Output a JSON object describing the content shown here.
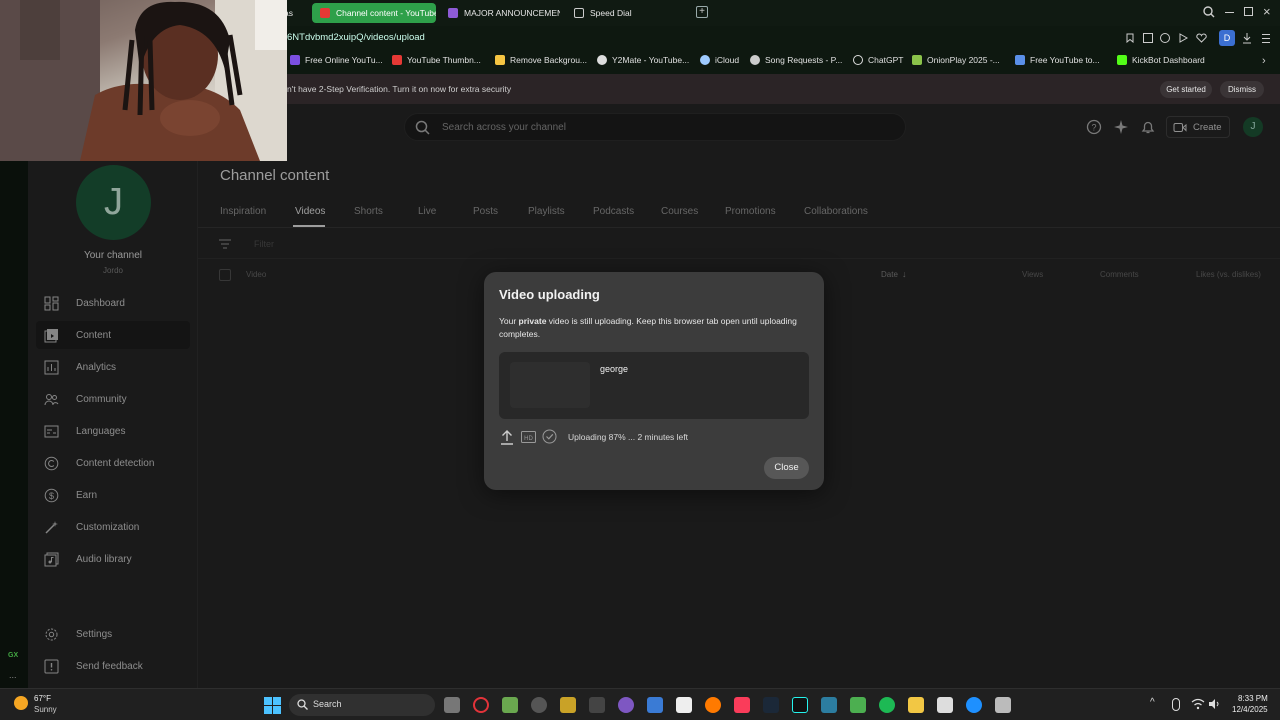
{
  "browser": {
    "tabs": [
      {
        "label": "as",
        "active": false
      },
      {
        "label": "Channel content - YouTube",
        "active": true
      },
      {
        "label": "MAJOR ANNOUNCEMENT",
        "active": false
      },
      {
        "label": "Speed Dial",
        "active": false
      }
    ],
    "address": "6NTdvbmd2xuipQ/videos/upload",
    "profile_initial": "D",
    "bookmarks": [
      {
        "label": "Free Online YouTu..."
      },
      {
        "label": "YouTube Thumbn..."
      },
      {
        "label": "Remove Backgrou..."
      },
      {
        "label": "Y2Mate - YouTube..."
      },
      {
        "label": "iCloud"
      },
      {
        "label": "Song Requests - P..."
      },
      {
        "label": "ChatGPT"
      },
      {
        "label": "OnionPlay 2025 -..."
      },
      {
        "label": "Free YouTube to..."
      },
      {
        "label": "KickBot Dashboard"
      }
    ]
  },
  "notice": {
    "text": "n't have 2-Step Verification. Turn it on now for extra security",
    "get_started": "Get started",
    "dismiss": "Dismiss"
  },
  "header": {
    "search_placeholder": "Search across your channel",
    "create_label": "Create",
    "avatar_initial": "J"
  },
  "sidebar": {
    "avatar_initial": "J",
    "channel_title": "Your channel",
    "channel_name": "Jordo",
    "items": [
      {
        "label": "Dashboard",
        "icon": "dashboard-icon"
      },
      {
        "label": "Content",
        "icon": "content-icon",
        "active": true
      },
      {
        "label": "Analytics",
        "icon": "analytics-icon"
      },
      {
        "label": "Community",
        "icon": "community-icon"
      },
      {
        "label": "Languages",
        "icon": "languages-icon"
      },
      {
        "label": "Content detection",
        "icon": "copyright-icon"
      },
      {
        "label": "Earn",
        "icon": "dollar-icon"
      },
      {
        "label": "Customization",
        "icon": "wand-icon"
      },
      {
        "label": "Audio library",
        "icon": "audio-library-icon"
      }
    ],
    "settings": "Settings",
    "feedback": "Send feedback"
  },
  "main": {
    "title": "Channel content",
    "tabs": [
      "Inspiration",
      "Videos",
      "Shorts",
      "Live",
      "Posts",
      "Playlists",
      "Podcasts",
      "Courses",
      "Promotions",
      "Collaborations"
    ],
    "active_tab": "Videos",
    "filter_placeholder": "Filter",
    "columns": {
      "video": "Video",
      "date": "Date",
      "views": "Views",
      "comments": "Comments",
      "likes": "Likes (vs. dislikes)"
    }
  },
  "modal": {
    "title": "Video uploading",
    "msg_prefix": "Your ",
    "msg_bold": "private",
    "msg_suffix": " video is still uploading. Keep this browser tab open until uploading completes.",
    "video_title": "george",
    "status": "Uploading 87% ... 2 minutes left",
    "progress": 0.87,
    "close": "Close"
  },
  "gx": {
    "label": "GX",
    "more": "..."
  },
  "taskbar": {
    "weather_temp": "67°F",
    "weather_desc": "Sunny",
    "search": "Search",
    "time": "8:33 PM",
    "date": "12/4/2025"
  }
}
